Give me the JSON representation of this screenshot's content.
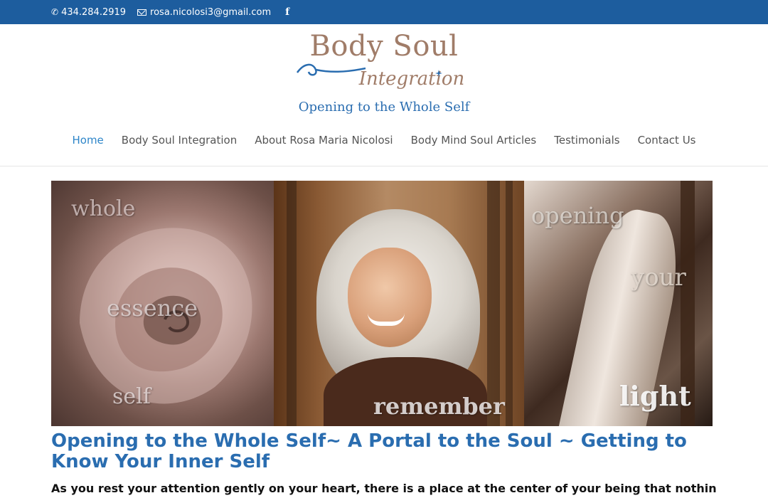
{
  "topbar": {
    "phone": "434.284.2919",
    "email": "rosa.nicolosi3@gmail.com",
    "facebook_glyph": "f",
    "icons": [
      "phone-icon",
      "mail-icon",
      "facebook-icon"
    ],
    "background": "#1d5d9e"
  },
  "logo": {
    "title": "Body Soul",
    "script": "Integration",
    "tagline": "Opening to the Whole Self",
    "colors": {
      "title": "#a07c68",
      "tagline": "#2a6db0"
    }
  },
  "nav": {
    "items": [
      {
        "label": "Home",
        "active": true
      },
      {
        "label": "Body Soul Integration",
        "active": false
      },
      {
        "label": "About Rosa Maria Nicolosi",
        "active": false
      },
      {
        "label": "Body Mind Soul Articles",
        "active": false
      },
      {
        "label": "Testimonials",
        "active": false
      },
      {
        "label": "Contact Us",
        "active": false
      }
    ],
    "active_color": "#2e86c9"
  },
  "banner": {
    "words": [
      "whole",
      "essence",
      "self",
      "remember",
      "opening",
      "your",
      "light"
    ]
  },
  "content": {
    "headline": "Opening to the Whole Self~ A Portal to the Soul ~ Getting to Know Your Inner Self",
    "intro": "As you rest your attention gently on your heart, there is a place at the center of your being that nothing and"
  }
}
